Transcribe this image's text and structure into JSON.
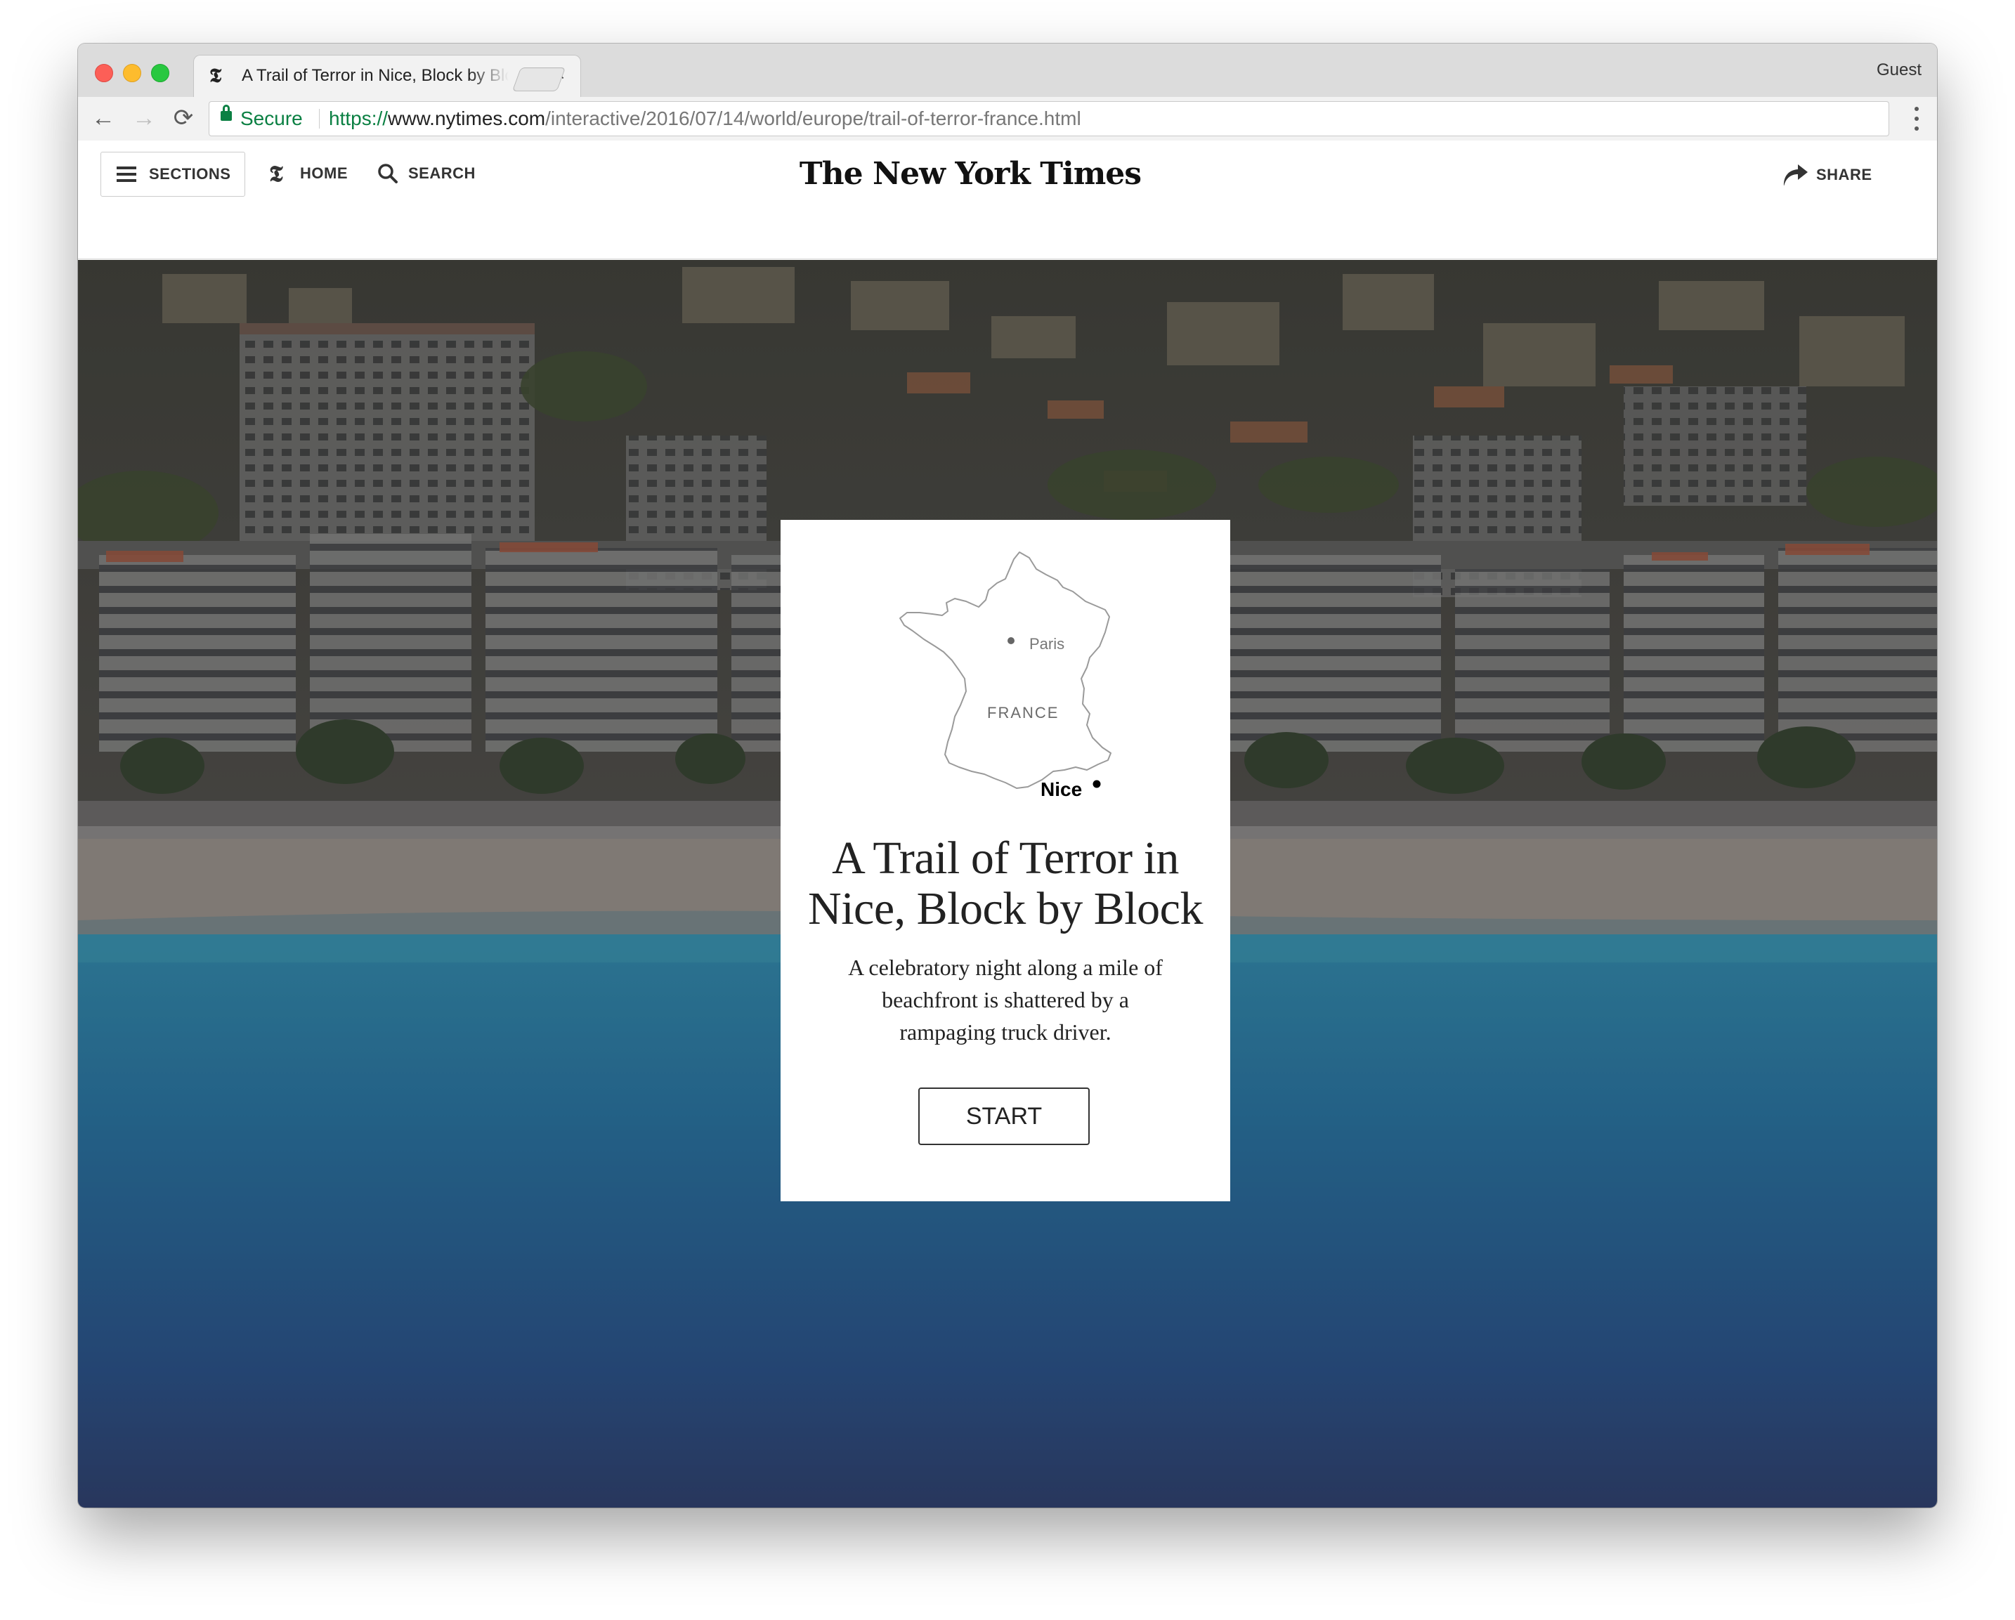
{
  "browser": {
    "tab_title": "A Trail of Terror in Nice, Block by Block",
    "tab_close": "×",
    "tab_favicon": "𝕿",
    "profile": "Guest",
    "secure_label": "Secure",
    "url_scheme": "https://",
    "url_host": "www.nytimes.com",
    "url_path": "/interactive/2016/07/14/world/europe/trail-of-terror-france.html",
    "nav_icons": {
      "back": "←",
      "forward": "→",
      "reload": "⟳"
    }
  },
  "masthead": {
    "sections_label": "SECTIONS",
    "home_label": "HOME",
    "home_icon": "𝕿",
    "search_label": "SEARCH",
    "brand": "The New York Times",
    "share_label": "SHARE"
  },
  "card": {
    "map": {
      "city_capital": "Paris",
      "country": "FRANCE",
      "city_highlight": "Nice"
    },
    "title": "A Trail of Terror in Nice, Block by Block",
    "subtitle": "A celebratory night along a mile of beachfront is shattered by a rampaging truck driver.",
    "start_label": "START"
  },
  "colors": {
    "secure_green": "#0b8043",
    "sea_top": "#2e8fb0",
    "sea_bottom": "#2a3f6b"
  }
}
